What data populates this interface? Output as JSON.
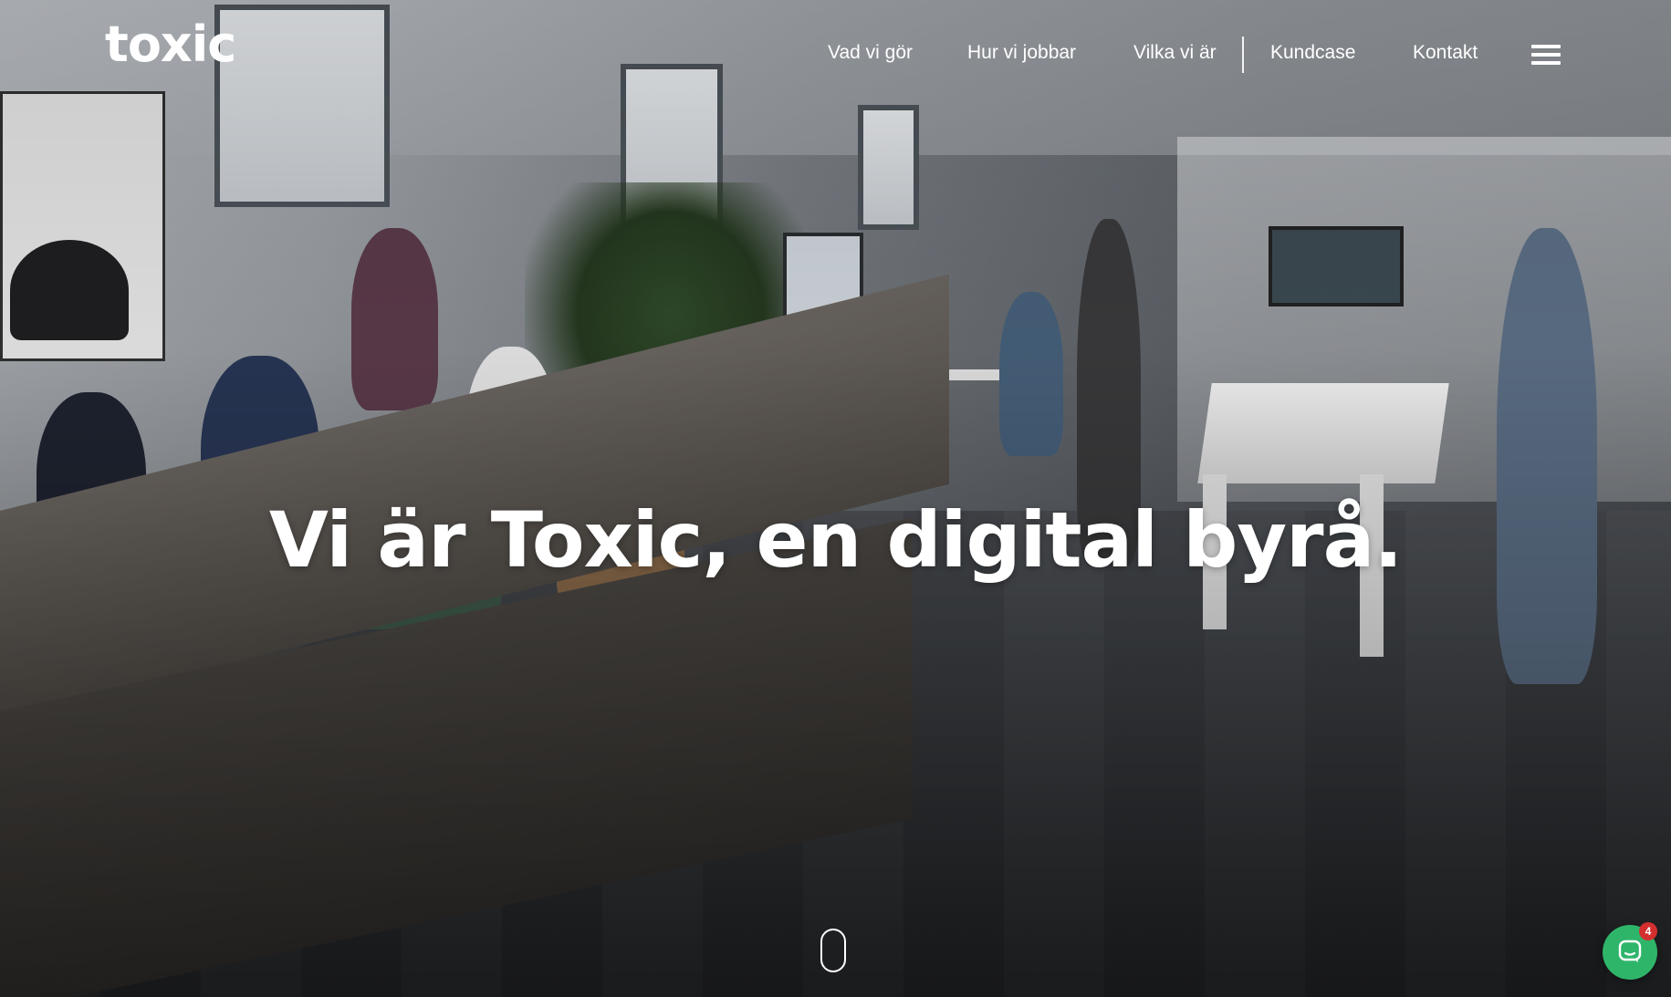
{
  "brand": {
    "logo_text": "toxic"
  },
  "nav": {
    "items": [
      {
        "label": "Vad vi gör"
      },
      {
        "label": "Hur vi jobbar"
      },
      {
        "label": "Vilka vi är"
      },
      {
        "label": "Kundcase"
      },
      {
        "label": "Kontakt"
      }
    ],
    "menu_icon": "hamburger-menu-icon"
  },
  "hero": {
    "headline": "Vi är Toxic, en digital byrå.",
    "scroll_icon": "mouse-scroll-icon"
  },
  "chat": {
    "icon": "chat-bubble-icon",
    "unread_count": "4",
    "accent_color": "#2fb56a",
    "badge_color": "#d32f2f"
  }
}
